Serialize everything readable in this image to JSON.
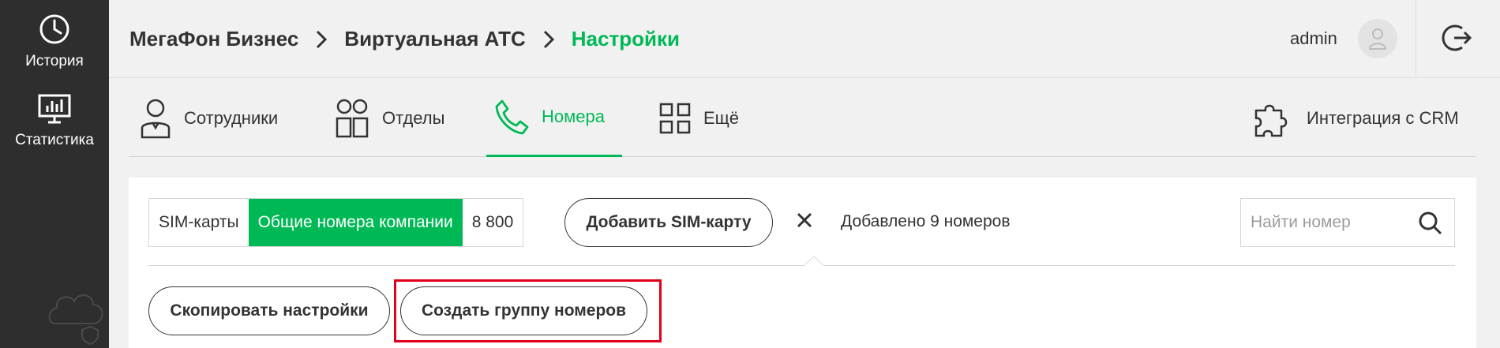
{
  "sidebar": {
    "items": [
      {
        "label": "История",
        "icon": "clock-icon"
      },
      {
        "label": "Статистика",
        "icon": "chart-monitor-icon"
      }
    ]
  },
  "header": {
    "breadcrumbs": [
      "МегаФон Бизнес",
      "Виртуальная АТС",
      "Настройки"
    ],
    "username": "admin"
  },
  "tabs": [
    {
      "label": "Сотрудники",
      "icon": "employee-icon"
    },
    {
      "label": "Отделы",
      "icon": "departments-icon"
    },
    {
      "label": "Номера",
      "icon": "phone-icon",
      "active": true
    },
    {
      "label": "Ещё",
      "icon": "grid-icon"
    },
    {
      "label": "Интеграция с CRM",
      "icon": "puzzle-icon"
    }
  ],
  "main": {
    "segments": [
      {
        "label": "SIM-карты"
      },
      {
        "label": "Общие номера компании",
        "selected": true
      },
      {
        "label": "8 800"
      }
    ],
    "add_sim_label": "Добавить SIM-карту",
    "added_text": "Добавлено 9 номеров",
    "search_placeholder": "Найти номер",
    "copy_settings_label": "Скопировать настройки",
    "create_group_label": "Создать группу номеров"
  },
  "colors": {
    "accent": "#00b956",
    "sidebar_bg": "#2e2e2e",
    "highlight": "#e0001b"
  }
}
